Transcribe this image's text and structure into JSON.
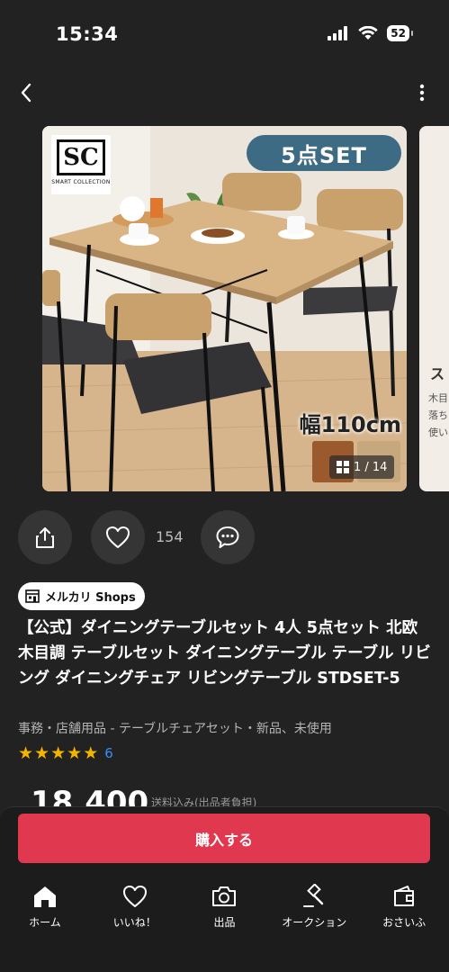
{
  "status": {
    "time": "15:34",
    "battery": "52"
  },
  "nav": {
    "back_icon": "chevron-left-icon",
    "more_icon": "more-vertical-icon"
  },
  "gallery": {
    "logo_letters": "SC",
    "logo_sub": "SMART COLLECTION",
    "set_badge": "5点SET",
    "width_label": "幅110cm",
    "counter": "1 / 14",
    "peek_lines": [
      "木目",
      "落ち",
      "使い"
    ],
    "peek_head": "ス"
  },
  "actions": {
    "like_count": "154"
  },
  "shop_badge": "メルカリ Shops",
  "product": {
    "title": "【公式】ダイニングテーブルセット 4人 5点セット 北欧 木目調 テーブルセット ダイニングテーブル テーブル リビング ダイニングチェア リビングテーブル STDSET-5",
    "category": "事務・店舗用品 - テーブルチェアセット・新品、未使用",
    "rating_stars": 5,
    "rating_count": "6",
    "price": "18,400",
    "price_note": "送料込み(出品者負担)"
  },
  "buy_button": "購入する",
  "tabs": [
    {
      "label": "ホーム",
      "icon": "home-icon"
    },
    {
      "label": "いいね！",
      "icon": "heart-icon"
    },
    {
      "label": "出品",
      "icon": "camera-icon"
    },
    {
      "label": "オークション",
      "icon": "gavel-icon"
    },
    {
      "label": "おさいふ",
      "icon": "wallet-icon"
    }
  ],
  "colors": {
    "background": "#222222",
    "accent": "#e0384f",
    "star": "#f4b400",
    "link": "#3a8df5"
  }
}
